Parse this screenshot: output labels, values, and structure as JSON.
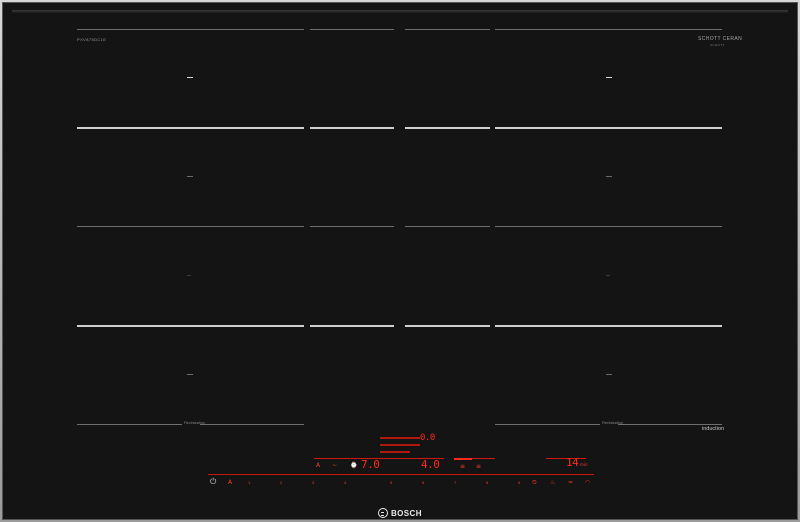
{
  "cooktop": {
    "model_code": "PXV875DC1E",
    "manufacturer_logo_text": "SCHOTT CERAN",
    "manufacturer_subtext": "SCHOTT",
    "zone_label_left": "FlexInduction",
    "zone_label_right": "FlexInduction",
    "induction_text": "induction",
    "brand_name": "BOSCH"
  },
  "display": {
    "timer_left": "7.0",
    "power_center": "4.0",
    "top_readout": "0.0",
    "right_readout": "14",
    "right_unit": "min"
  },
  "controls": {
    "power_symbol": "⏻",
    "scale": [
      "1",
      "2",
      "3",
      "4",
      "5",
      "6",
      "7",
      "8",
      "9"
    ],
    "left_icons": [
      "A",
      "~",
      "⌚"
    ],
    "right_icons": [
      "⏲",
      "♨",
      "≈"
    ]
  },
  "colors": {
    "glass": "#141414",
    "display_red": "#ff2a1a",
    "frame": "#b0b0b0"
  }
}
